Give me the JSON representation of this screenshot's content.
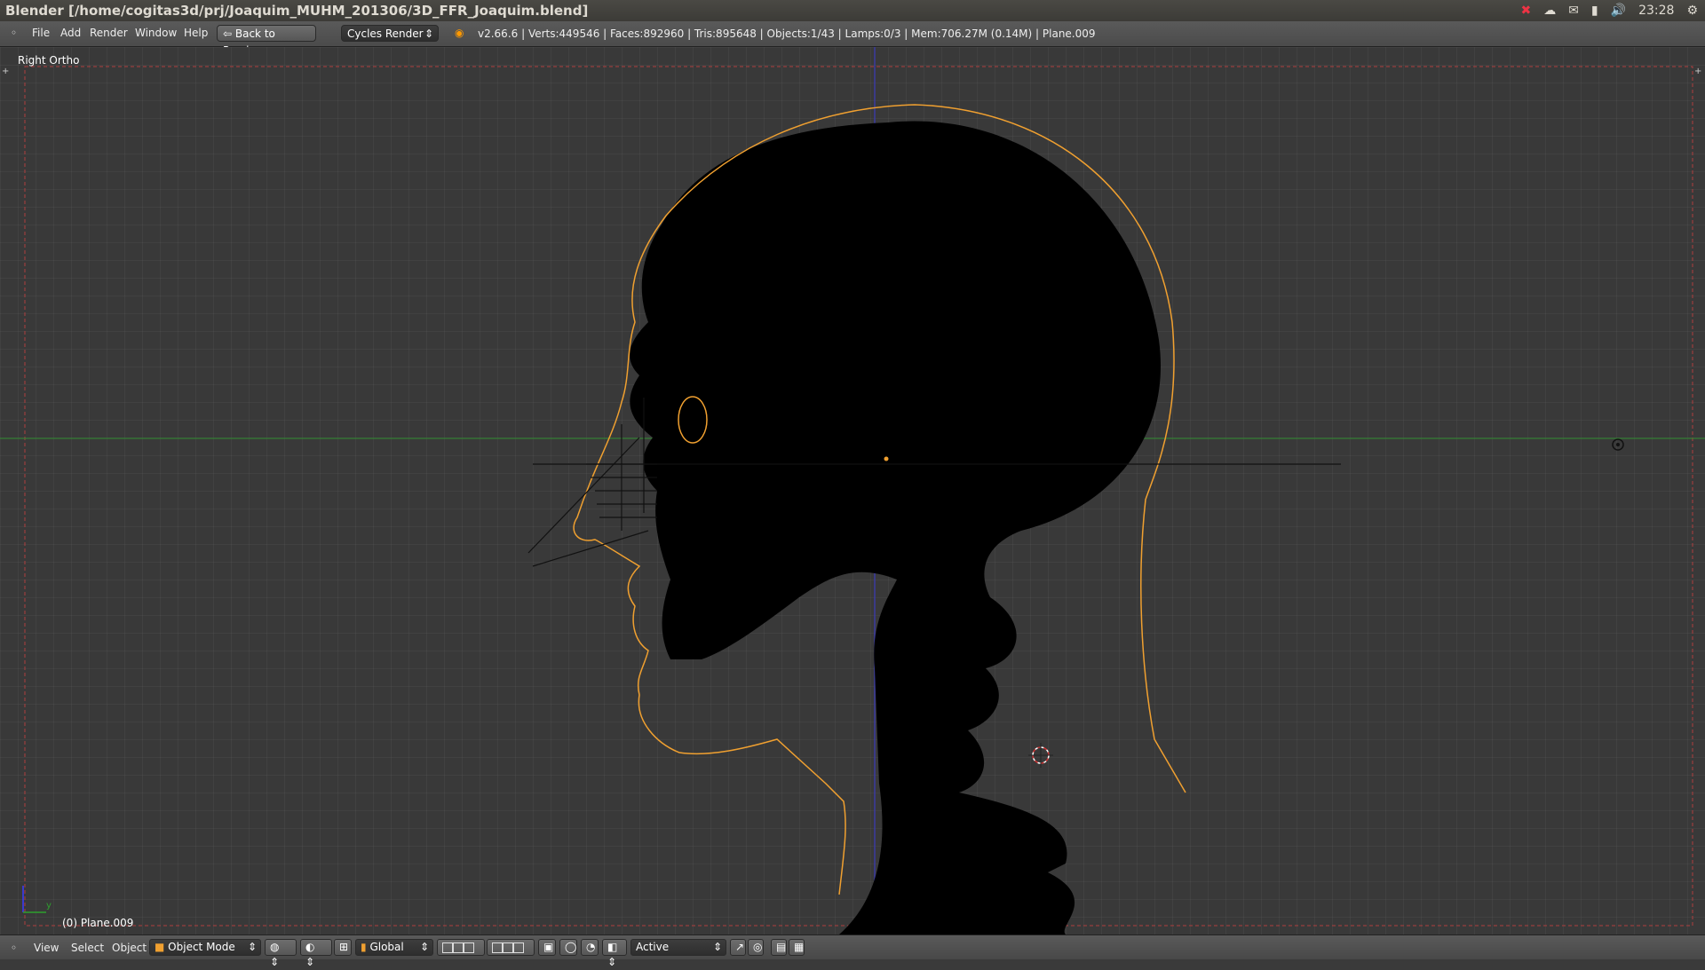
{
  "window": {
    "title": "Blender [/home/cogitas3d/prj/Joaquim_MUHM_201306/3D_FFR_Joaquim.blend]"
  },
  "tray": {
    "clock": "23:28"
  },
  "menu": {
    "items": [
      "File",
      "Add",
      "Render",
      "Window",
      "Help"
    ],
    "back_label": "Back to Previous",
    "engine": "Cycles Render"
  },
  "stats": {
    "text": "v2.66.6 | Verts:449546 | Faces:892960 | Tris:895648 | Objects:1/43 | Lamps:0/3 | Mem:706.27M (0.14M) | Plane.009"
  },
  "viewport": {
    "view_name": "Right Ortho",
    "object_label": "(0) Plane.009",
    "axis_y": "y"
  },
  "footer": {
    "items": [
      "View",
      "Select",
      "Object"
    ],
    "mode": "Object Mode",
    "orientation": "Global",
    "pivot": "Active"
  },
  "colors": {
    "outline": "#f0a030",
    "x_axis": "#2e8b2e",
    "z_axis": "#3a3aa0",
    "skull": "#000000"
  }
}
